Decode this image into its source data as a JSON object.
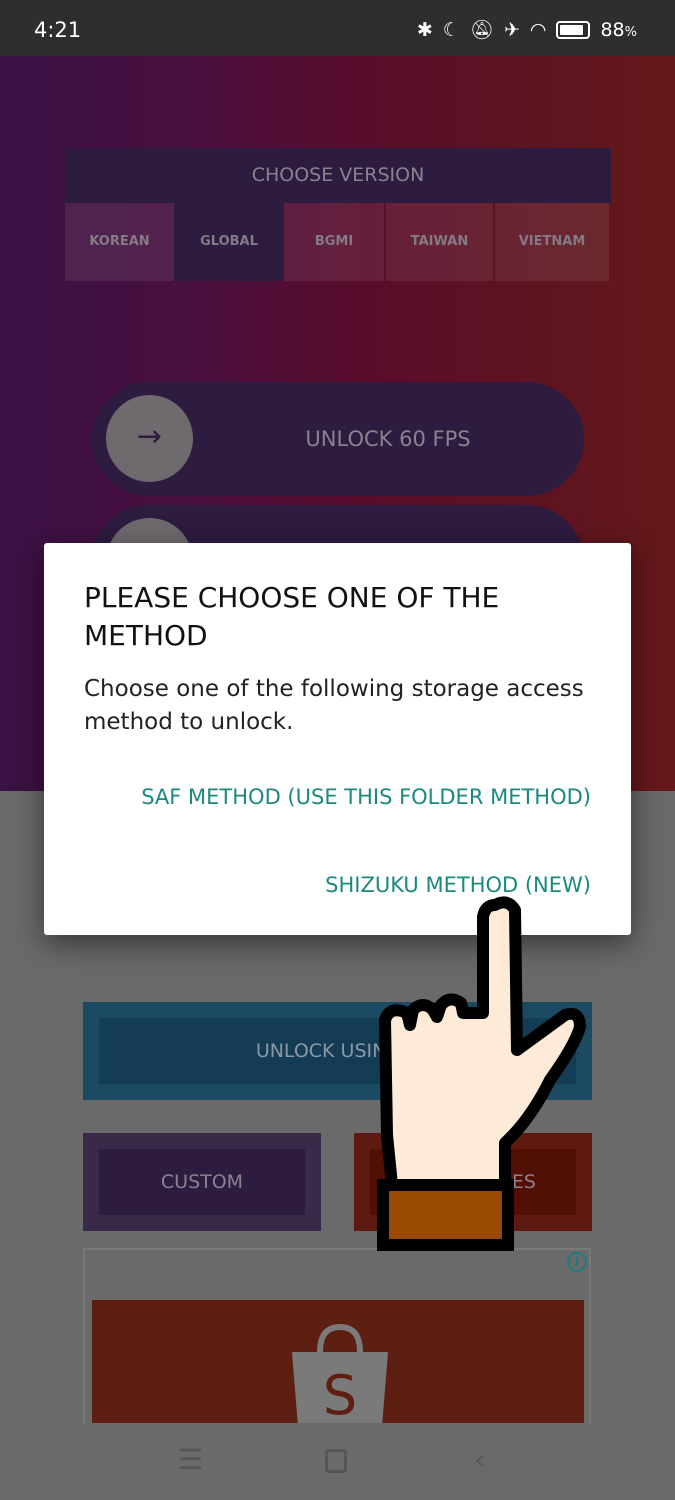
{
  "status_bar": {
    "time": "4:21",
    "battery": "88",
    "battery_unit": "%",
    "icons": [
      "bluetooth-icon",
      "moon-icon",
      "vibrate-off-icon",
      "airplane-icon",
      "wifi-icon",
      "battery-icon"
    ]
  },
  "version": {
    "title": "CHOOSE VERSION",
    "tabs": [
      "KOREAN",
      "GLOBAL",
      "BGMI",
      "TAIWAN",
      "VIETNAM"
    ],
    "selected": "GLOBAL"
  },
  "fps_button": {
    "label": "UNLOCK 60 FPS"
  },
  "dialog": {
    "title": "PLEASE CHOOSE ONE OF THE METHOD",
    "message": "Choose one of the following storage access method to unlock.",
    "saf": "SAF METHOD (USE THIS FOLDER METHOD)",
    "shizuku": "SHIZUKU METHOD (NEW)"
  },
  "buttons": {
    "unlock_using": "UNLOCK USING S",
    "custom": "CUSTOM",
    "other": "ES"
  },
  "ad": {
    "info": "i",
    "brand_letter": "S"
  },
  "colors": {
    "accent": "#1a8a7e"
  }
}
